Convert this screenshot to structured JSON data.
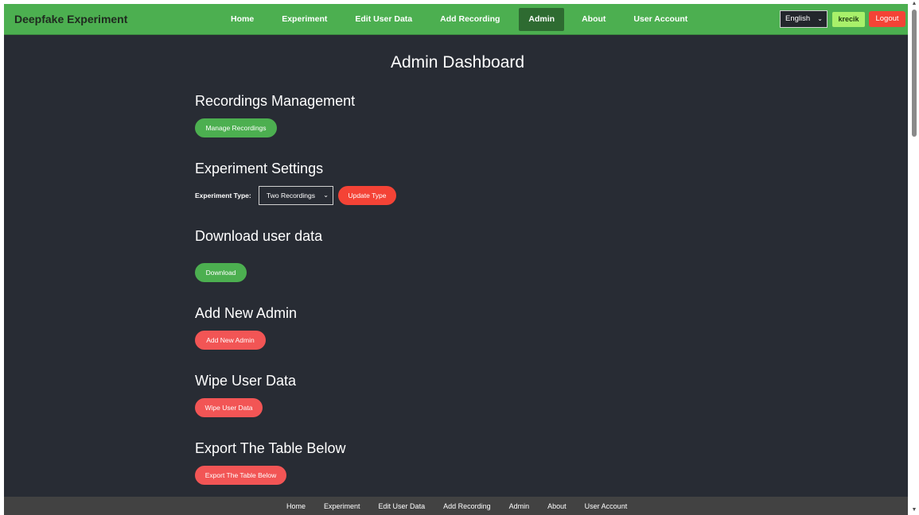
{
  "header": {
    "brand": "Deepfake Experiment",
    "nav": [
      {
        "label": "Home",
        "active": false
      },
      {
        "label": "Experiment",
        "active": false
      },
      {
        "label": "Edit User Data",
        "active": false
      },
      {
        "label": "Add Recording",
        "active": false
      },
      {
        "label": "Admin",
        "active": true
      },
      {
        "label": "About",
        "active": false
      },
      {
        "label": "User Account",
        "active": false
      }
    ],
    "language": "English",
    "username": "krecik",
    "logout_label": "Logout"
  },
  "main": {
    "title": "Admin Dashboard",
    "recordings": {
      "heading": "Recordings Management",
      "button": "Manage Recordings"
    },
    "settings": {
      "heading": "Experiment Settings",
      "type_label": "Experiment Type:",
      "type_value": "Two Recordings",
      "update_button": "Update Type"
    },
    "download": {
      "heading": "Download user data",
      "button": "Download"
    },
    "add_admin": {
      "heading": "Add New Admin",
      "button": "Add New Admin"
    },
    "wipe": {
      "heading": "Wipe User Data",
      "button": "Wipe User Data"
    },
    "export": {
      "heading": "Export The Table Below",
      "button": "Export The Table Below"
    }
  },
  "footer": {
    "links": [
      "Home",
      "Experiment",
      "Edit User Data",
      "Add Recording",
      "Admin",
      "About",
      "User Account"
    ]
  },
  "colors": {
    "nav_green": "#4caf50",
    "active_tab": "#2e6b31",
    "background": "#282c34",
    "button_green": "#4caf50",
    "button_red": "#f25555",
    "logout_red": "#f44336",
    "user_badge": "#a8f06a",
    "footer": "#424242"
  },
  "icons": {
    "select_chevron": "chevron-down-icon",
    "scroll_up": "scroll-up-arrow-icon",
    "scroll_down": "scroll-down-arrow-icon"
  }
}
